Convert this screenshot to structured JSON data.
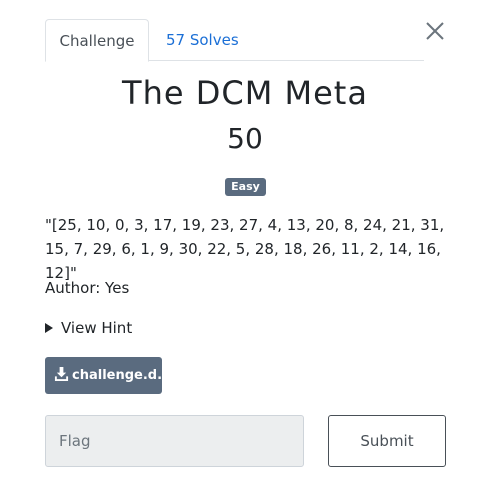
{
  "tabs": [
    {
      "label": "Challenge"
    },
    {
      "label": "57 Solves"
    }
  ],
  "challenge": {
    "name": "The DCM Meta",
    "points": "50",
    "difficulty_badge": "Easy",
    "description": "\"[25, 10, 0, 3, 17, 19, 23, 27, 4, 13, 20, 8, 24, 21, 31, 15, 7, 29, 6, 1, 9, 30, 22, 5, 28, 18, 26, 11, 2, 14, 16, 12]\"",
    "author": "Author: Yes",
    "hint_label": "View Hint",
    "file_label": "challenge.d..."
  },
  "form": {
    "flag_placeholder": "Flag",
    "submit_label": "Submit"
  },
  "colors": {
    "link": "#1b6fd6",
    "badge": "#5a6b7f",
    "button": "#5a6b7f"
  },
  "icons": {
    "close": "close-icon",
    "download": "download-icon",
    "hint": "caret-right-icon"
  }
}
